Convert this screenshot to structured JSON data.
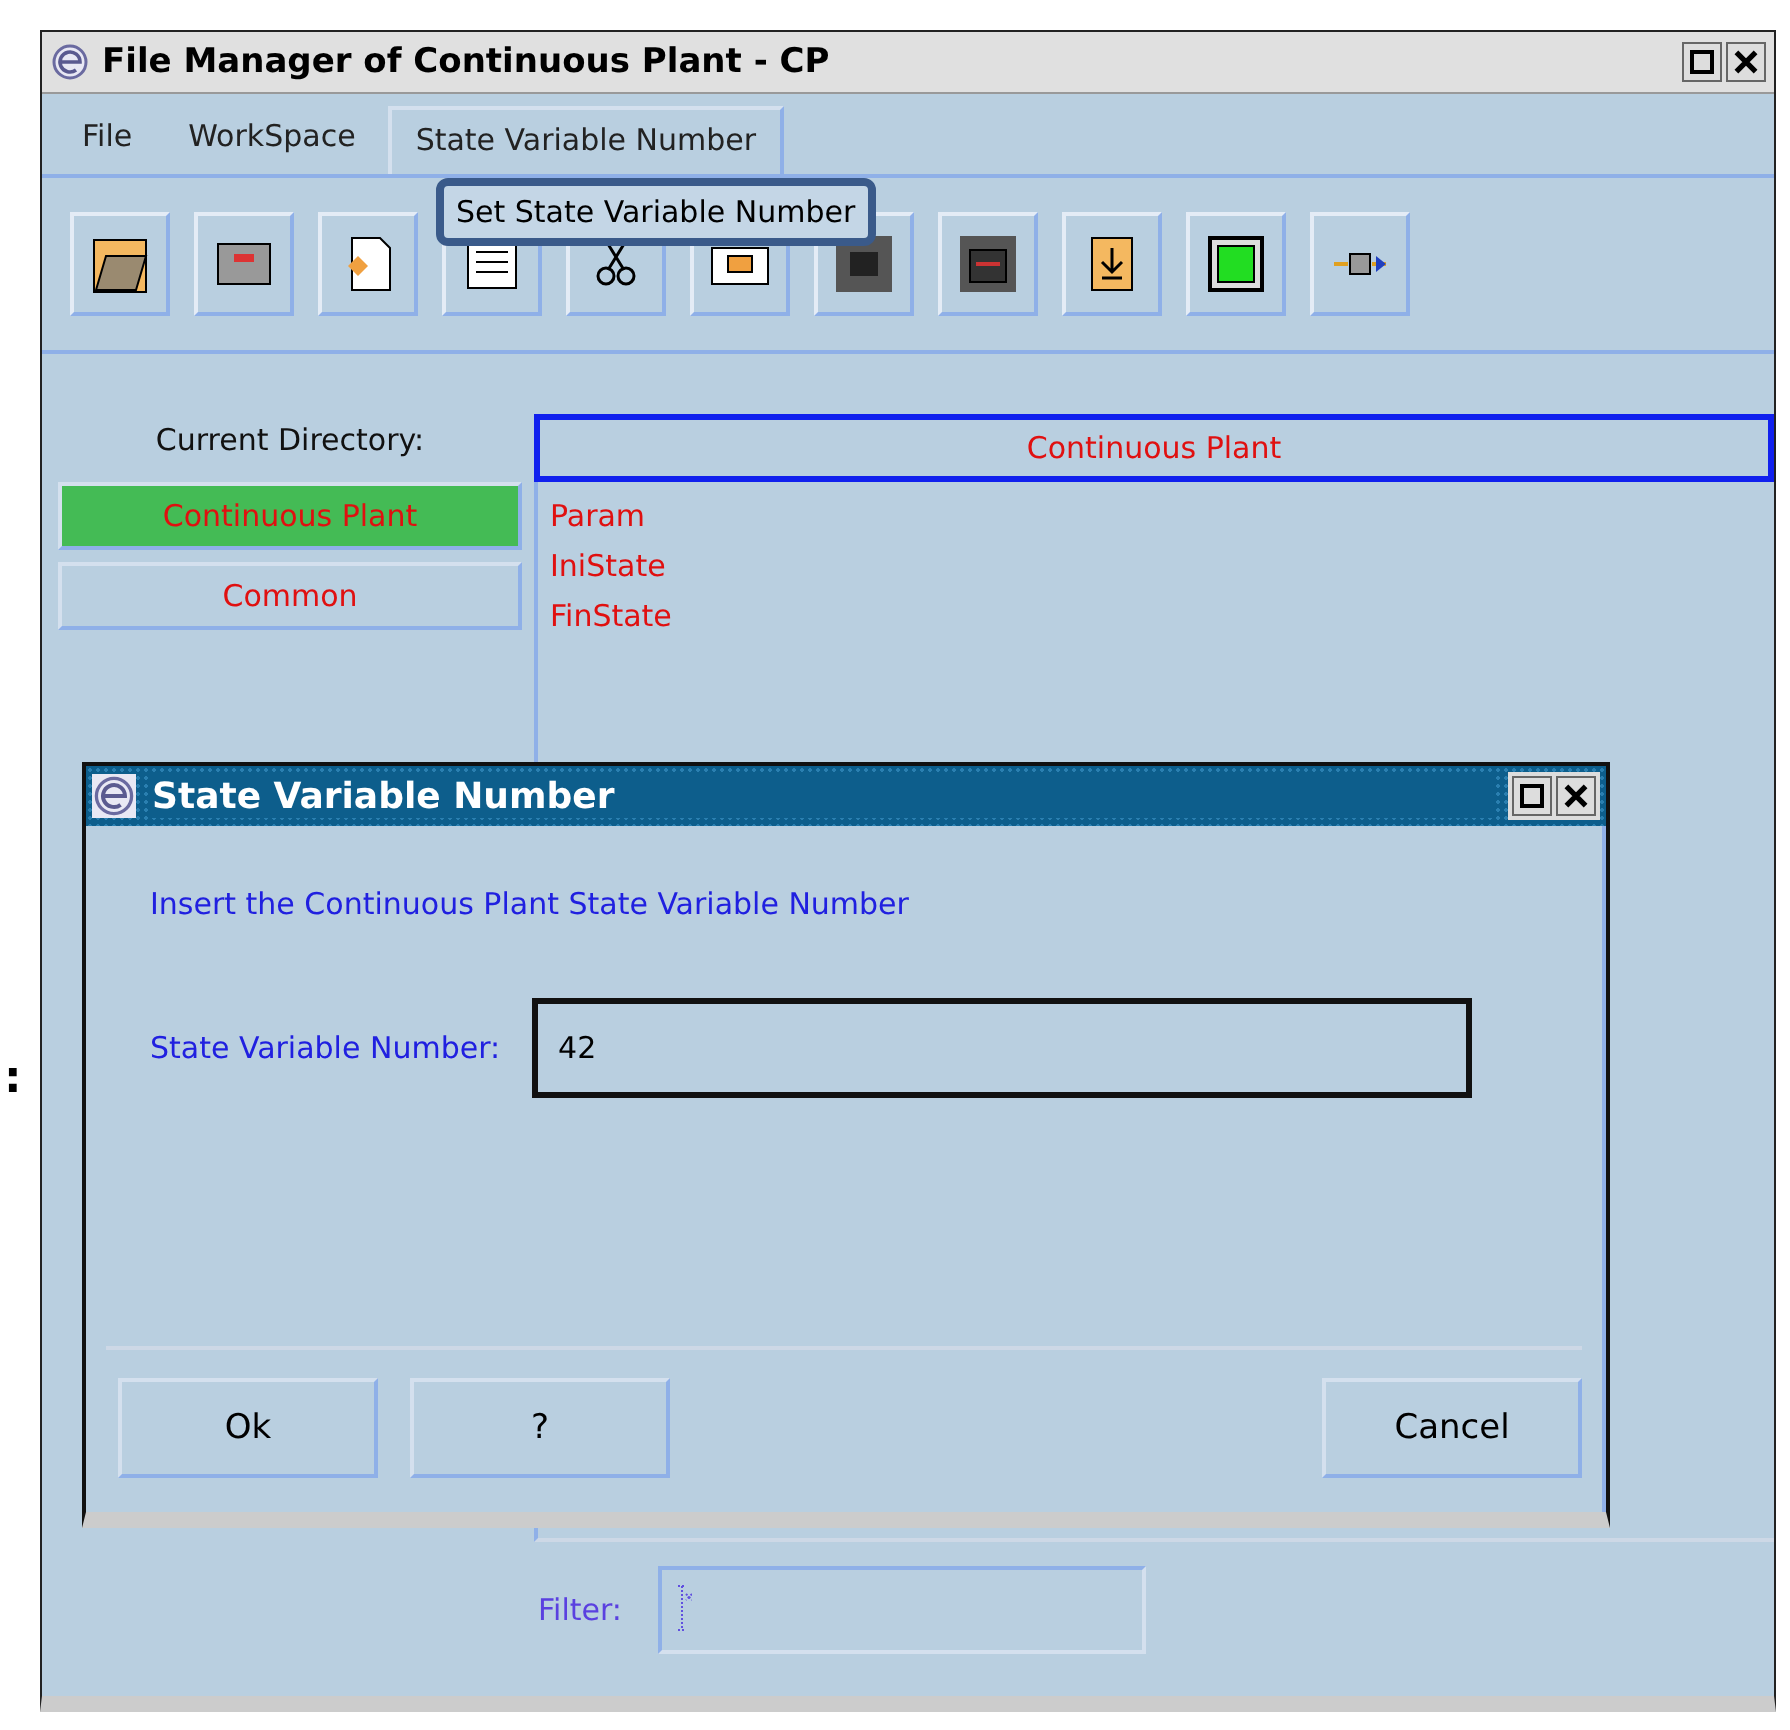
{
  "window": {
    "title": "File Manager of Continuous Plant - CP"
  },
  "menu": [
    {
      "label": "File",
      "selected": false
    },
    {
      "label": "WorkSpace",
      "selected": false
    },
    {
      "label": "State Variable Number",
      "selected": true
    }
  ],
  "menu_popup": {
    "items": [
      "Set State Variable Number"
    ]
  },
  "current_directory_label": "Current Directory:",
  "directories": [
    {
      "label": "Continuous Plant",
      "selected": true
    },
    {
      "label": "Common",
      "selected": false
    }
  ],
  "file_list": {
    "header": "Continuous Plant",
    "items": [
      "Param",
      "IniState",
      "FinState"
    ]
  },
  "filter": {
    "label": "Filter:"
  },
  "stray_mark": ":",
  "dialog": {
    "title": "State Variable Number",
    "message": "Insert the Continuous Plant State Variable Number",
    "field_label": "State Variable Number:",
    "value": "42",
    "buttons": [
      "Ok",
      "?",
      "Cancel"
    ]
  }
}
